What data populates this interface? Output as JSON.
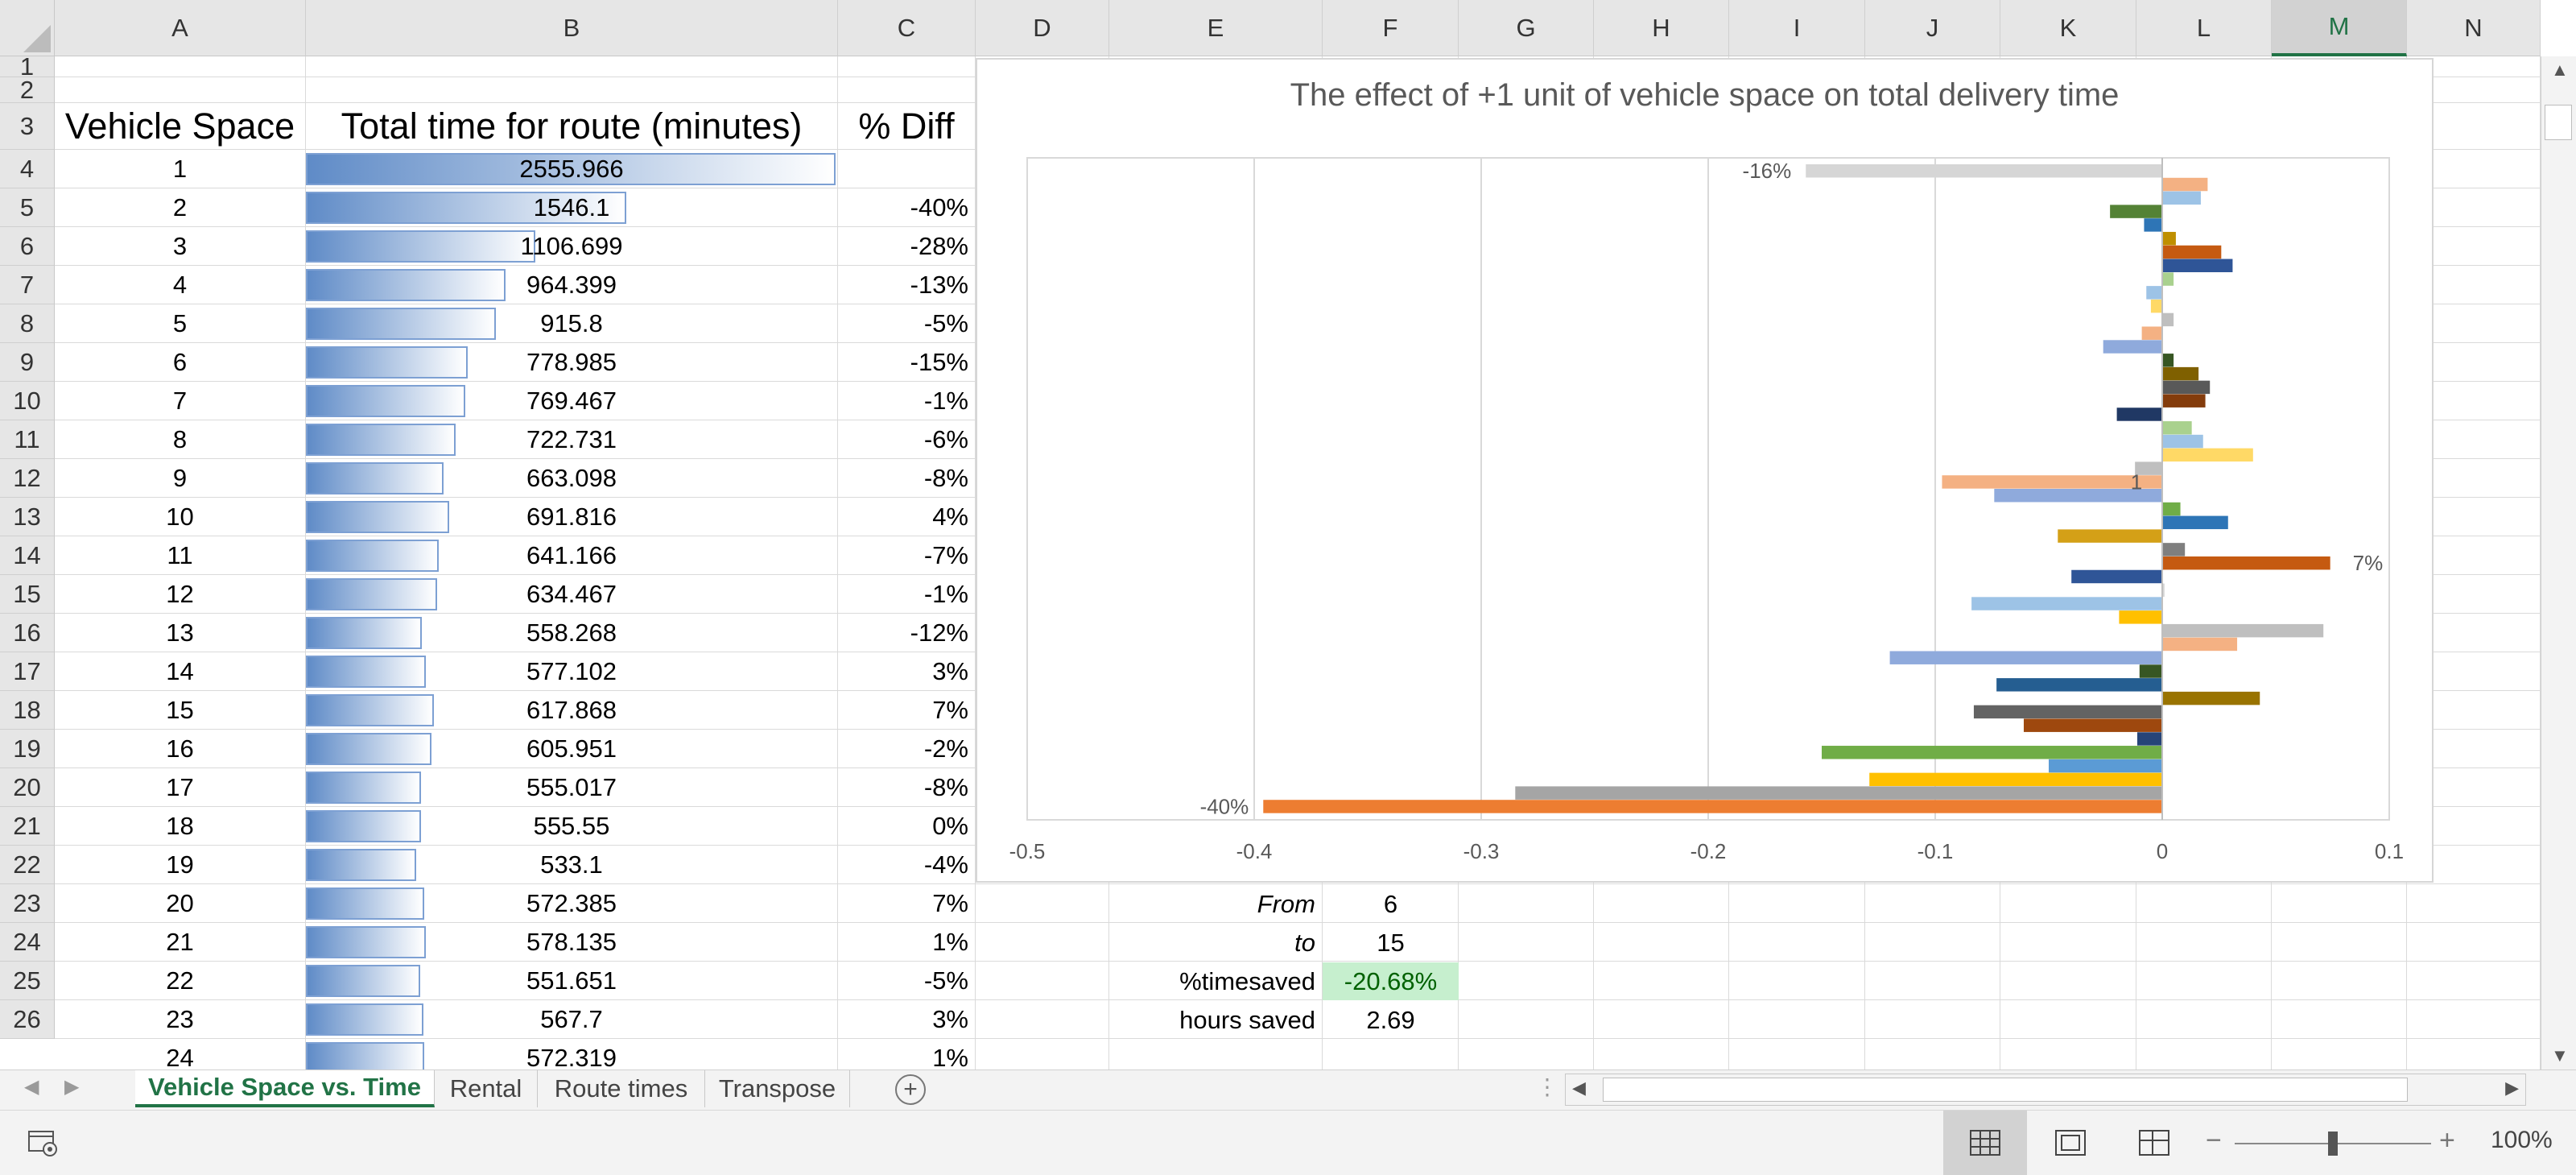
{
  "columns": [
    "A",
    "B",
    "C",
    "D",
    "E",
    "F",
    "G",
    "H",
    "I",
    "J",
    "K",
    "L",
    "M",
    "N"
  ],
  "selected_column": "M",
  "rows": [
    "1",
    "2",
    "3",
    "4",
    "5",
    "6",
    "7",
    "8",
    "9",
    "10",
    "11",
    "12",
    "13",
    "14",
    "15",
    "16",
    "17",
    "18",
    "19",
    "20",
    "21",
    "22",
    "23",
    "24",
    "25",
    "26"
  ],
  "headers": {
    "a": "Vehicle Space",
    "b": "Total time for route (minutes)",
    "c": "% Diff"
  },
  "table": [
    {
      "space": "1",
      "time": "2555.966",
      "diff": ""
    },
    {
      "space": "2",
      "time": "1546.1",
      "diff": "-40%"
    },
    {
      "space": "3",
      "time": "1106.699",
      "diff": "-28%"
    },
    {
      "space": "4",
      "time": "964.399",
      "diff": "-13%"
    },
    {
      "space": "5",
      "time": "915.8",
      "diff": "-5%"
    },
    {
      "space": "6",
      "time": "778.985",
      "diff": "-15%"
    },
    {
      "space": "7",
      "time": "769.467",
      "diff": "-1%"
    },
    {
      "space": "8",
      "time": "722.731",
      "diff": "-6%"
    },
    {
      "space": "9",
      "time": "663.098",
      "diff": "-8%"
    },
    {
      "space": "10",
      "time": "691.816",
      "diff": "4%"
    },
    {
      "space": "11",
      "time": "641.166",
      "diff": "-7%"
    },
    {
      "space": "12",
      "time": "634.467",
      "diff": "-1%"
    },
    {
      "space": "13",
      "time": "558.268",
      "diff": "-12%"
    },
    {
      "space": "14",
      "time": "577.102",
      "diff": "3%"
    },
    {
      "space": "15",
      "time": "617.868",
      "diff": "7%"
    },
    {
      "space": "16",
      "time": "605.951",
      "diff": "-2%"
    },
    {
      "space": "17",
      "time": "555.017",
      "diff": "-8%"
    },
    {
      "space": "18",
      "time": "555.55",
      "diff": "0%"
    },
    {
      "space": "19",
      "time": "533.1",
      "diff": "-4%"
    },
    {
      "space": "20",
      "time": "572.385",
      "diff": "7%"
    },
    {
      "space": "21",
      "time": "578.135",
      "diff": "1%"
    },
    {
      "space": "22",
      "time": "551.651",
      "diff": "-5%"
    },
    {
      "space": "23",
      "time": "567.7",
      "diff": "3%"
    },
    {
      "space": "24",
      "time": "572.319",
      "diff": "1%"
    }
  ],
  "databar_max": 2555.966,
  "summary": {
    "from_label": "From",
    "from_value": "6",
    "to_label": "to",
    "to_value": "15",
    "timesaved_label": "%timesaved",
    "timesaved_value": "-20.68%",
    "hours_label": "hours saved",
    "hours_value": "2.69"
  },
  "highlight_colors": {
    "green_fill": "#c6efce",
    "green_text": "#006100",
    "databar": "#5f8bc7"
  },
  "chart_data": {
    "type": "bar",
    "orientation": "horizontal",
    "title": "The effect of +1 unit of vehicle space on total delivery time",
    "xlim": [
      -0.5,
      0.1
    ],
    "x_ticks": [
      "-0.5",
      "-0.4",
      "-0.3",
      "-0.2",
      "-0.1",
      "0",
      "0.1"
    ],
    "grid": true,
    "values": [
      -0.157,
      0.02,
      0.017,
      -0.023,
      -0.008,
      0.006,
      0.026,
      0.031,
      0.005,
      -0.007,
      -0.005,
      0.005,
      -0.009,
      -0.026,
      0.005,
      0.016,
      0.021,
      0.019,
      -0.02,
      0.013,
      0.018,
      0.04,
      -0.012,
      -0.097,
      -0.074,
      0.008,
      0.029,
      -0.046,
      0.01,
      0.074,
      -0.04,
      0.001,
      -0.084,
      -0.019,
      0.071,
      0.033,
      -0.12,
      -0.01,
      -0.073,
      0.043,
      -0.083,
      -0.061,
      -0.011,
      -0.15,
      -0.05,
      -0.129,
      -0.285,
      -0.396
    ],
    "colors": [
      "#d6d6d6",
      "#f4b183",
      "#9dc3e6",
      "#548235",
      "#2e75b6",
      "#bf8f00",
      "#c55a11",
      "#2f5597",
      "#a9d18e",
      "#9dc3e6",
      "#ffd966",
      "#bfbfbf",
      "#f4b183",
      "#8faadc",
      "#375623",
      "#7f6000",
      "#595959",
      "#843c0c",
      "#203864",
      "#a9d18e",
      "#9dc3e6",
      "#ffd966",
      "#bfbfbf",
      "#f4b183",
      "#8faadc",
      "#70ad47",
      "#2e75b6",
      "#d4a017",
      "#7f7f7f",
      "#c55a11",
      "#2f5597",
      "#d6d6d6",
      "#9dc3e6",
      "#ffc000",
      "#bfbfbf",
      "#f4b183",
      "#8faadc",
      "#375623",
      "#255e91",
      "#997300",
      "#636363",
      "#9e480e",
      "#264478",
      "#70ad47",
      "#5b9bd5",
      "#ffc000",
      "#a5a5a5",
      "#ed7d31"
    ],
    "data_labels": [
      {
        "index": 0,
        "text": "-16%"
      },
      {
        "index": 29,
        "text": "7%"
      },
      {
        "index": 47,
        "text": "-40%"
      },
      {
        "index": 23,
        "text": "1"
      }
    ]
  },
  "sheet_tabs": [
    "Vehicle Space vs. Time",
    "Rental",
    "Route times",
    "Transpose"
  ],
  "active_tab": "Vehicle Space vs. Time",
  "zoom": "100%"
}
